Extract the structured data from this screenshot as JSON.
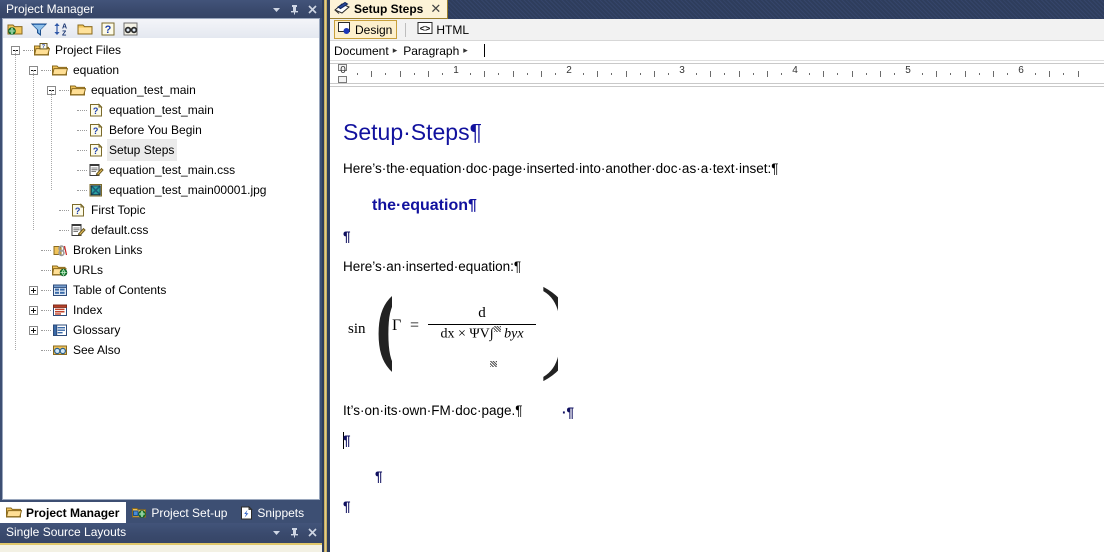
{
  "left_panel": {
    "title": "Project Manager",
    "titlebar_buttons": [
      {
        "name": "dropdown-icon",
        "glyph": "▾"
      },
      {
        "name": "pin-icon",
        "glyph": "⇯"
      },
      {
        "name": "close-icon",
        "glyph": "✕"
      }
    ],
    "toolbar_icons": [
      "add-project-folder-icon",
      "filter-icon",
      "sort-az-icon",
      "new-folder-icon",
      "topic-properties-icon",
      "find-icon"
    ],
    "tree": [
      {
        "label": "Project Files",
        "depth": 0,
        "icon": "project-folder-icon",
        "expander": "minus",
        "selected": false
      },
      {
        "label": "equation",
        "depth": 1,
        "icon": "folder-icon",
        "expander": "minus",
        "selected": false
      },
      {
        "label": "equation_test_main",
        "depth": 2,
        "icon": "folder-icon",
        "expander": "minus",
        "selected": false
      },
      {
        "label": "equation_test_main",
        "depth": 3,
        "icon": "topic-icon",
        "expander": "none",
        "selected": false
      },
      {
        "label": "Before You Begin",
        "depth": 3,
        "icon": "topic-icon",
        "expander": "none",
        "selected": false
      },
      {
        "label": "Setup Steps",
        "depth": 3,
        "icon": "topic-icon",
        "expander": "none",
        "selected": true
      },
      {
        "label": "equation_test_main.css",
        "depth": 3,
        "icon": "css-icon",
        "expander": "none",
        "selected": false
      },
      {
        "label": "equation_test_main00001.jpg",
        "depth": 3,
        "icon": "image-icon",
        "expander": "none",
        "selected": false
      },
      {
        "label": "First Topic",
        "depth": 2,
        "icon": "topic-icon",
        "expander": "none",
        "selected": false
      },
      {
        "label": "default.css",
        "depth": 2,
        "icon": "css-icon",
        "expander": "none",
        "selected": false
      },
      {
        "label": "Broken Links",
        "depth": 1,
        "icon": "broken-links-icon",
        "expander": "none",
        "selected": false
      },
      {
        "label": "URLs",
        "depth": 1,
        "icon": "urls-icon",
        "expander": "none",
        "selected": false
      },
      {
        "label": "Table of Contents",
        "depth": 1,
        "icon": "toc-icon",
        "expander": "plus",
        "selected": false
      },
      {
        "label": "Index",
        "depth": 1,
        "icon": "index-icon",
        "expander": "plus",
        "selected": false
      },
      {
        "label": "Glossary",
        "depth": 1,
        "icon": "glossary-icon",
        "expander": "plus",
        "selected": false
      },
      {
        "label": "See Also",
        "depth": 1,
        "icon": "see-also-icon",
        "expander": "none",
        "selected": false
      }
    ],
    "dock_tabs": [
      {
        "label": "Project Manager",
        "icon": "folder-icon",
        "active": true
      },
      {
        "label": "Project Set-up",
        "icon": "project-setup-icon",
        "active": false
      },
      {
        "label": "Snippets",
        "icon": "snippets-icon",
        "active": false
      }
    ],
    "bottom_panel": {
      "title": "Single Source Layouts",
      "titlebar_buttons": [
        {
          "name": "dropdown-icon",
          "glyph": "▾"
        },
        {
          "name": "pin-icon",
          "glyph": "⇯"
        },
        {
          "name": "close-icon",
          "glyph": "✕"
        }
      ]
    }
  },
  "editor": {
    "tab": {
      "label": "Setup Steps",
      "close": "✕",
      "icon": "topic-editor-icon"
    },
    "modes": [
      {
        "label": "Design",
        "active": true,
        "icon": "design-icon"
      },
      {
        "label": "HTML",
        "active": false,
        "icon": "html-icon"
      }
    ],
    "breadcrumb": [
      {
        "label": "Document",
        "arrow": "▸"
      },
      {
        "label": "Paragraph",
        "arrow": "▸"
      }
    ],
    "ruler": {
      "unit": "inches",
      "labels": [
        "0",
        "1",
        "2",
        "3",
        "4",
        "5",
        "6"
      ],
      "max": 6.5
    },
    "document": {
      "heading1": "Setup·Steps¶",
      "para1": "Here’s·the·equation·doc·page·inserted·into·another·doc·as·a·text·inset:¶",
      "heading2": "the·equation¶",
      "empty1": "¶",
      "para2": "Here’s·an·inserted·equation:¶",
      "equation": {
        "function": "sin",
        "left_paren": "(",
        "right_paren": ")",
        "variable": "Γ",
        "operator": "=",
        "numerator": "d",
        "denominator_prefix": "dx × ΨV∫",
        "denominator_suffix": "byx",
        "trailing": "·¶"
      },
      "para3": "It’s·on·its·own·FM·doc·page.¶",
      "empty2": "¶",
      "empty3": "¶",
      "empty4": "¶"
    }
  },
  "colors": {
    "chrome_blue": "#3d4f73",
    "titlebar_blue": "#3a4a6d",
    "tab_cream": "#fdf3d7",
    "tab_border_gold": "#9a7f2e",
    "heading_navy": "#11119e",
    "selection_gray": "#ebebeb",
    "gold_strip": "#d9c27e"
  }
}
